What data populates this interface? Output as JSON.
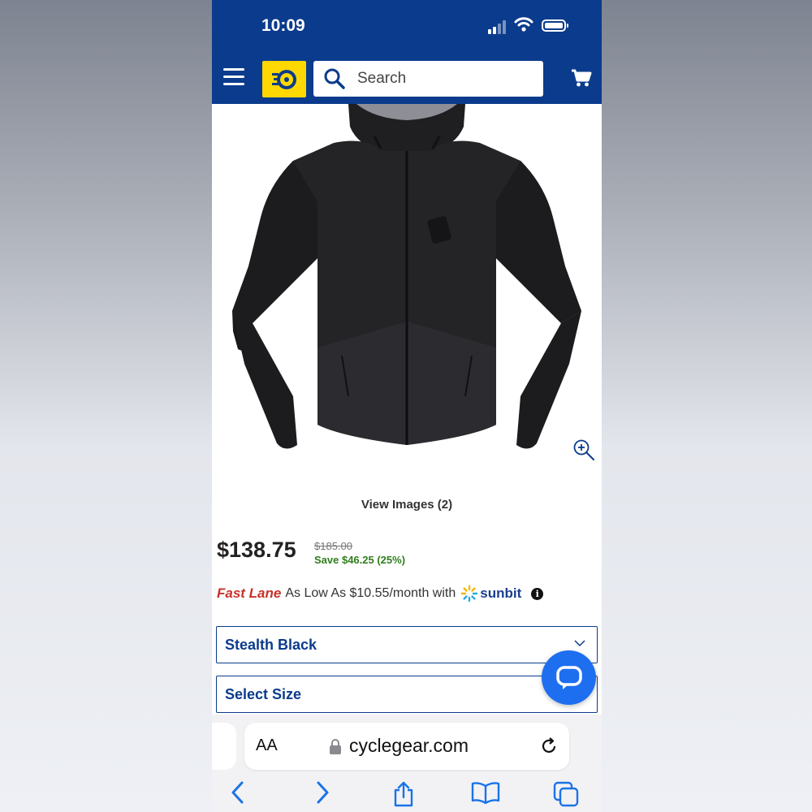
{
  "status_bar": {
    "time": "10:09"
  },
  "header": {
    "search_placeholder": "Search",
    "icons": [
      "menu-icon",
      "cyclegear-logo",
      "search-icon",
      "cart-icon"
    ],
    "colors": {
      "bar": "#0b3b8c",
      "logo_bg": "#ffd800"
    }
  },
  "product": {
    "view_images_label": "View Images (2)",
    "price": "$138.75",
    "original_price": "$185.00",
    "savings": "Save $46.25 (25%)",
    "financing": {
      "brand": "Fast Lane",
      "text": "As Low As $10.55/month with",
      "provider": "sunbit"
    },
    "color_select": "Stealth Black",
    "size_select": "Select Size"
  },
  "browser": {
    "text_size_label": "AA",
    "url": "cyclegear.com"
  }
}
